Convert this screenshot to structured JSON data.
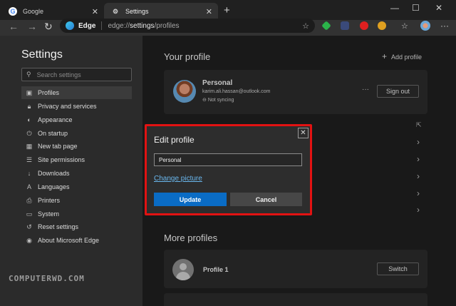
{
  "tabs": [
    {
      "title": "Google",
      "icon": "google-icon"
    },
    {
      "title": "Settings",
      "icon": "gear-icon"
    }
  ],
  "address": {
    "brand": "Edge",
    "url_prefix": "edge://",
    "url_host": "settings",
    "url_path": "/profiles"
  },
  "sidebar": {
    "title": "Settings",
    "search_placeholder": "Search settings",
    "items": [
      {
        "label": "Profiles",
        "icon": "profile-icon"
      },
      {
        "label": "Privacy and services",
        "icon": "lock-icon"
      },
      {
        "label": "Appearance",
        "icon": "palette-icon"
      },
      {
        "label": "On startup",
        "icon": "power-icon"
      },
      {
        "label": "New tab page",
        "icon": "grid-icon"
      },
      {
        "label": "Site permissions",
        "icon": "permissions-icon"
      },
      {
        "label": "Downloads",
        "icon": "download-icon"
      },
      {
        "label": "Languages",
        "icon": "language-icon"
      },
      {
        "label": "Printers",
        "icon": "printer-icon"
      },
      {
        "label": "System",
        "icon": "laptop-icon"
      },
      {
        "label": "Reset settings",
        "icon": "reset-icon"
      },
      {
        "label": "About Microsoft Edge",
        "icon": "edge-icon"
      }
    ]
  },
  "main": {
    "heading": "Your profile",
    "add_profile": "Add profile",
    "profile": {
      "name": "Personal",
      "email": "karim.ali.hassan@outlook.com",
      "sync": "Not syncing",
      "signout": "Sign out"
    },
    "more_heading": "More profiles",
    "other_profile": {
      "name": "Profile 1",
      "switch": "Switch"
    }
  },
  "dialog": {
    "title": "Edit profile",
    "name_value": "Personal",
    "change_picture": "Change picture",
    "update": "Update",
    "cancel": "Cancel"
  },
  "watermark": "COMPUTERWD.COM",
  "colors": {
    "accent": "#0a6cc5",
    "highlight": "#e21212",
    "link": "#6ab8ef"
  }
}
